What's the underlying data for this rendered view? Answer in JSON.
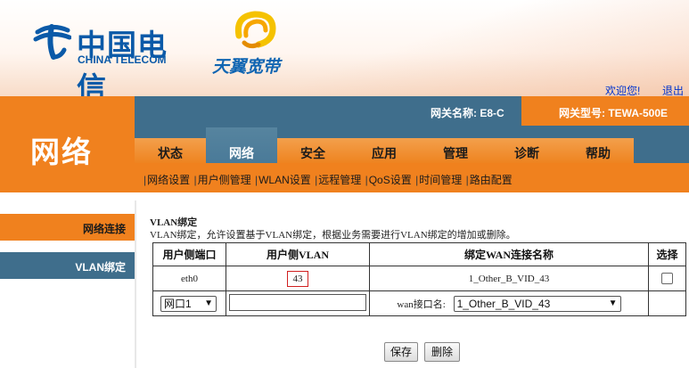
{
  "brand": {
    "telecom_cn": "中国电信",
    "telecom_en": "CHINA TELECOM",
    "tianyi": "天翼宽带"
  },
  "header": {
    "welcome": "欢迎您!",
    "logout": "退出",
    "gateway_name": "网关名称:  E8-C",
    "gateway_model": "网关型号: TEWA-500E"
  },
  "page_title": "网络",
  "tabs": [
    "状态",
    "网络",
    "安全",
    "应用",
    "管理",
    "诊断",
    "帮助"
  ],
  "active_tab": "网络",
  "subnav": [
    "网络设置",
    "用户侧管理",
    "WLAN设置",
    "远程管理",
    "QoS设置",
    "时间管理",
    "路由配置"
  ],
  "left_nav": {
    "connection": "网络连接",
    "vlan_binding": "VLAN绑定"
  },
  "section": {
    "title": "VLAN绑定",
    "description": "VLAN绑定，允许设置基于VLAN绑定，根据业务需要进行VLAN绑定的增加或删除。"
  },
  "table": {
    "headers": [
      "用户侧端口",
      "用户侧VLAN",
      "绑定WAN连接名称",
      "选择"
    ],
    "rows": [
      {
        "port": "eth0",
        "vlan": "43",
        "wan": "1_Other_B_VID_43"
      }
    ],
    "new_row": {
      "port_select": "网口1",
      "vlan_input": "",
      "wan_label": "wan接口名:",
      "wan_select": "1_Other_B_VID_43"
    }
  },
  "buttons": {
    "save": "保存",
    "delete": "删除"
  },
  "colors": {
    "orange": "#f0811e",
    "steel_blue": "#3f6e8c",
    "brand_blue": "#0b5aa8"
  }
}
